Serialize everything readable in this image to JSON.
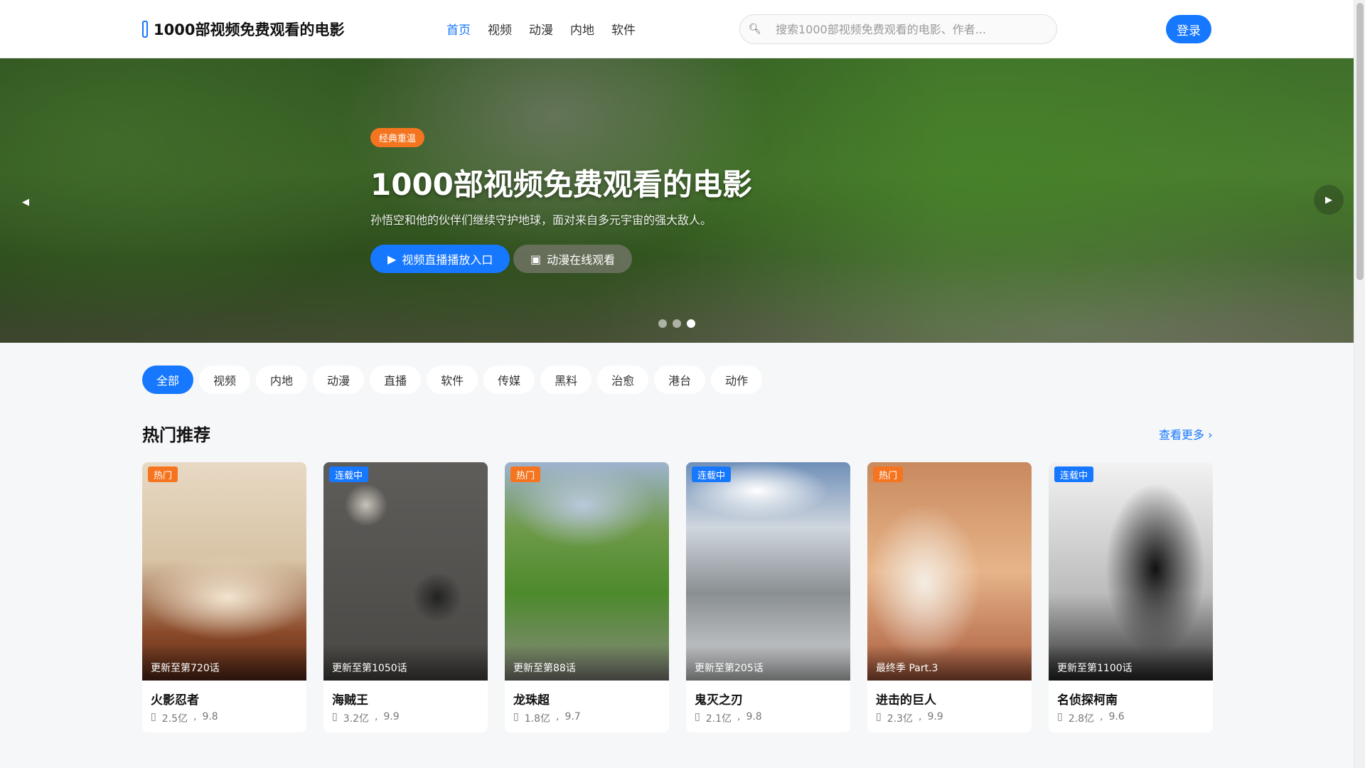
{
  "header": {
    "logo_text": "1000部视频免费观看的电影",
    "nav": [
      {
        "label": "首页",
        "active": true
      },
      {
        "label": "视频",
        "active": false
      },
      {
        "label": "动漫",
        "active": false
      },
      {
        "label": "内地",
        "active": false
      },
      {
        "label": "软件",
        "active": false
      }
    ],
    "search_placeholder": "搜索1000部视频免费观看的电影、作者...",
    "login_label": "登录"
  },
  "hero": {
    "badge": "经典重温",
    "title": "1000部视频免费观看的电影",
    "subtitle": "孙悟空和他的伙伴们继续守护地球，面对来自多元宇宙的强大敌人。",
    "primary_button": "视频直播播放入口",
    "secondary_button": "动漫在线观看",
    "active_slide": 3,
    "slide_count": 3
  },
  "categories": [
    {
      "label": "全部",
      "active": true
    },
    {
      "label": "视频",
      "active": false
    },
    {
      "label": "内地",
      "active": false
    },
    {
      "label": "动漫",
      "active": false
    },
    {
      "label": "直播",
      "active": false
    },
    {
      "label": "软件",
      "active": false
    },
    {
      "label": "传媒",
      "active": false
    },
    {
      "label": "黑料",
      "active": false
    },
    {
      "label": "治愈",
      "active": false
    },
    {
      "label": "港台",
      "active": false
    },
    {
      "label": "动作",
      "active": false
    }
  ],
  "section": {
    "title": "热门推荐",
    "more_label": "查看更多"
  },
  "cards": [
    {
      "tag": "热门",
      "tag_type": "hot",
      "update": "更新至第720话",
      "name": "火影忍者",
      "views": "2.5亿",
      "rating": "9.8"
    },
    {
      "tag": "连载中",
      "tag_type": "ser",
      "update": "更新至第1050话",
      "name": "海贼王",
      "views": "3.2亿",
      "rating": "9.9"
    },
    {
      "tag": "热门",
      "tag_type": "hot",
      "update": "更新至第88话",
      "name": "龙珠超",
      "views": "1.8亿",
      "rating": "9.7"
    },
    {
      "tag": "连载中",
      "tag_type": "ser",
      "update": "更新至第205话",
      "name": "鬼灭之刃",
      "views": "2.1亿",
      "rating": "9.8"
    },
    {
      "tag": "热门",
      "tag_type": "hot",
      "update": "最终季 Part.3",
      "name": "进击的巨人",
      "views": "2.3亿",
      "rating": "9.9"
    },
    {
      "tag": "连载中",
      "tag_type": "ser",
      "update": "更新至第1100话",
      "name": "名侦探柯南",
      "views": "2.8亿",
      "rating": "9.6"
    }
  ],
  "colors": {
    "accent": "#1677ff",
    "hot": "#f5741f"
  }
}
